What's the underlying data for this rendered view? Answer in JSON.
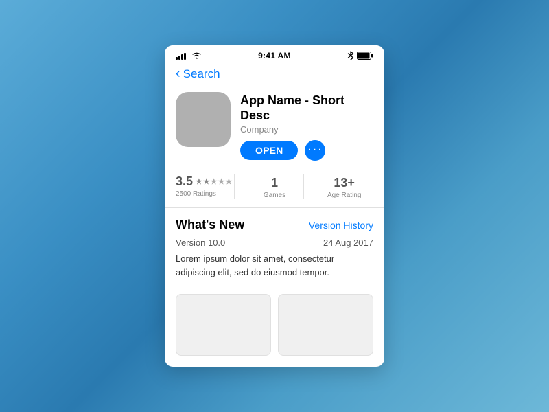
{
  "statusBar": {
    "time": "9:41 AM",
    "signal": "full",
    "wifi": true,
    "bluetooth": true,
    "battery": "full"
  },
  "navigation": {
    "backLabel": "Search"
  },
  "app": {
    "name": "App Name - Short Desc",
    "company": "Company",
    "openButtonLabel": "OPEN",
    "moreButtonLabel": "···"
  },
  "ratings": {
    "score": "3.5",
    "starsLabel": "★★☆☆☆",
    "ratingsCount": "2500 Ratings",
    "gamesCount": "1",
    "gamesLabel": "Games",
    "ageRating": "13+",
    "ageLabel": "Age Rating"
  },
  "whatsNew": {
    "title": "What's New",
    "versionHistoryLabel": "Version History",
    "versionNumber": "Version 10.0",
    "versionDate": "24 Aug 2017",
    "description": "Lorem ipsum dolor sit amet, consectetur adipiscing elit, sed do eiusmod tempor."
  }
}
